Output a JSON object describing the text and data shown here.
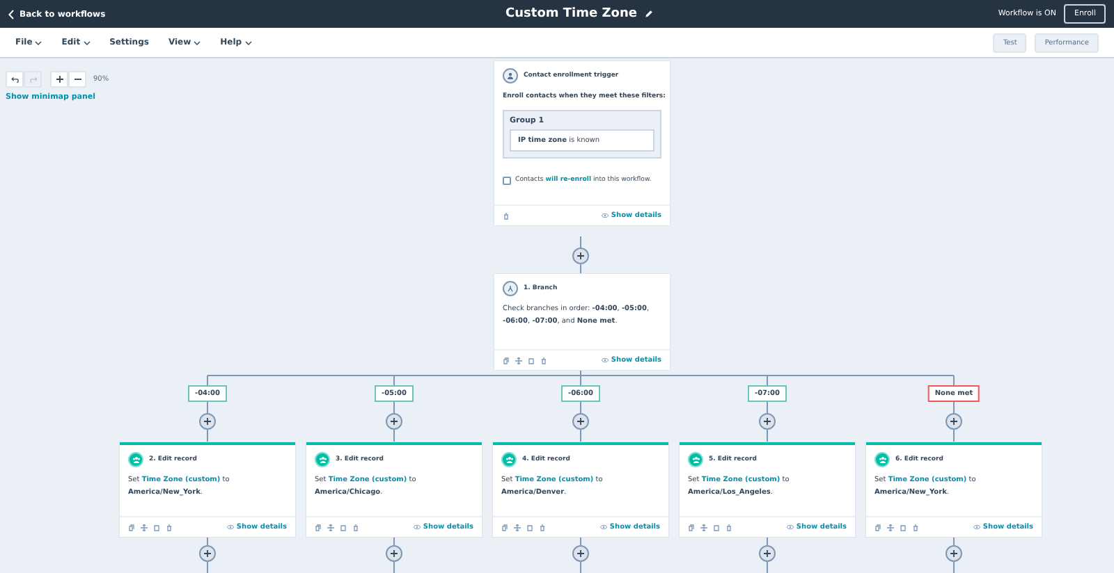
{
  "header": {
    "back_link": "Back to workflows",
    "title": "Custom Time Zone",
    "status": "Workflow is ON",
    "enroll_button": "Enroll"
  },
  "menu": [
    {
      "label": "File",
      "has_menu": true
    },
    {
      "label": "Edit",
      "has_menu": true
    },
    {
      "label": "Settings",
      "has_menu": false
    },
    {
      "label": "View",
      "has_menu": true
    },
    {
      "label": "Help",
      "has_menu": true
    }
  ],
  "menu_buttons": [
    "Test",
    "Performance"
  ],
  "zoom_controls": {
    "undo_disabled": false,
    "redo_disabled": true,
    "zoom": "90%",
    "minimap_link": "Show minimap panel"
  },
  "trigger": {
    "title": "Contact enrollment trigger",
    "intro": "Enroll contacts when they meet these filters:",
    "group": "Group 1",
    "filter": "**IP time zone** is known",
    "reenroll": {
      "checked": false,
      "before": "Contacts",
      "link": "will re-enroll",
      "after": "into this workflow."
    },
    "details_link": "Show details"
  },
  "branch": {
    "title": "1. Branch",
    "text": "Check branches in order: **-04:00**, **-05:00**, **-06:00**, **-07:00**, and **None met**.",
    "details_link": "Show details"
  },
  "branches": [
    {
      "label": "-04:00",
      "color": "#6ac2b8",
      "action": {
        "title": "2. Edit record",
        "before": "Set",
        "property": "Time Zone (custom)",
        "middle": "to",
        "value": "America/New_York",
        "end": ".",
        "details_link": "Show details"
      }
    },
    {
      "label": "-05:00",
      "color": "#6ac2b8",
      "action": {
        "title": "3. Edit record",
        "before": "Set",
        "property": "Time Zone (custom)",
        "middle": "to",
        "value": "America/Chicago",
        "end": ".",
        "details_link": "Show details"
      }
    },
    {
      "label": "-06:00",
      "color": "#6ac2b8",
      "action": {
        "title": "4. Edit record",
        "before": "Set",
        "property": "Time Zone (custom)",
        "middle": "to",
        "value": "America/Denver",
        "end": ".",
        "details_link": "Show details"
      }
    },
    {
      "label": "-07:00",
      "color": "#6ac2b8",
      "action": {
        "title": "5. Edit record",
        "before": "Set",
        "property": "Time Zone (custom)",
        "middle": "to",
        "value": "America/Los_Angeles",
        "end": ".",
        "details_link": "Show details"
      }
    },
    {
      "label": "None met",
      "color": "#f2545b",
      "action": {
        "title": "6. Edit record",
        "before": "Set",
        "property": "Time Zone (custom)",
        "middle": "to",
        "value": "America/New_York",
        "end": ".",
        "details_link": "Show details"
      }
    }
  ]
}
